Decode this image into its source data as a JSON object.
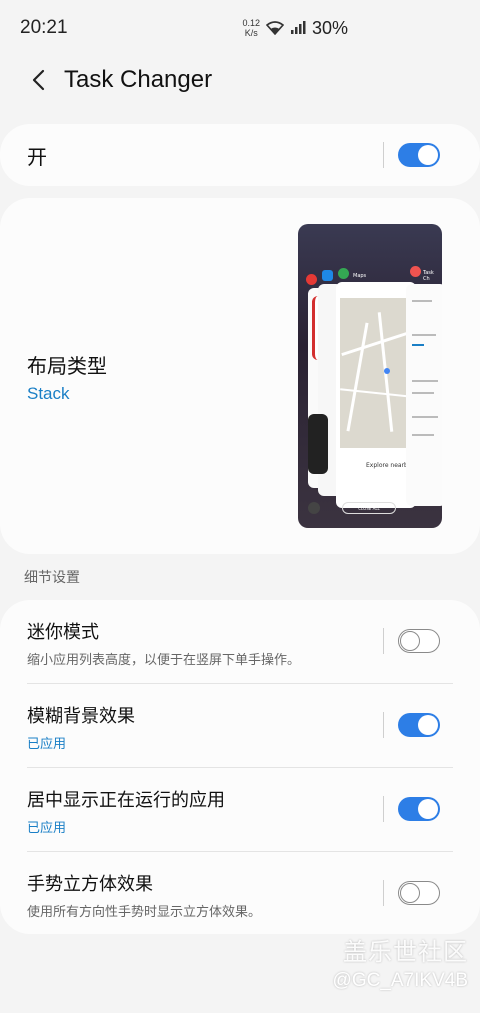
{
  "status_bar": {
    "time": "20:21",
    "net_speed_value": "0.12",
    "net_speed_unit": "K/s",
    "battery": "30%"
  },
  "app_bar": {
    "title": "Task Changer"
  },
  "master_switch": {
    "label": "开",
    "enabled": true
  },
  "layout": {
    "title": "布局类型",
    "value": "Stack",
    "preview": {
      "map_caption": "Maps",
      "task_caption": "Task Ch",
      "close_all": "CLOSE ALL",
      "explore": "Explore nearby"
    }
  },
  "details": {
    "header": "细节设置",
    "items": [
      {
        "title": "迷你模式",
        "subtitle": "缩小应用列表高度，以便于在竖屏下单手操作。",
        "enabled": false
      },
      {
        "title": "模糊背景效果",
        "subtitle": "已应用",
        "enabled": true
      },
      {
        "title": "居中显示正在运行的应用",
        "subtitle": "已应用",
        "enabled": true
      },
      {
        "title": "手势立方体效果",
        "subtitle": "使用所有方向性手势时显示立方体效果。",
        "enabled": false
      }
    ]
  },
  "watermark": {
    "brand": "盖乐世社区",
    "user": "@GC_A7IKV4B"
  },
  "colors": {
    "accent": "#2d7ee6",
    "link": "#1a7fc6",
    "background": "#f4f4f4",
    "card": "#fcfcfc"
  }
}
